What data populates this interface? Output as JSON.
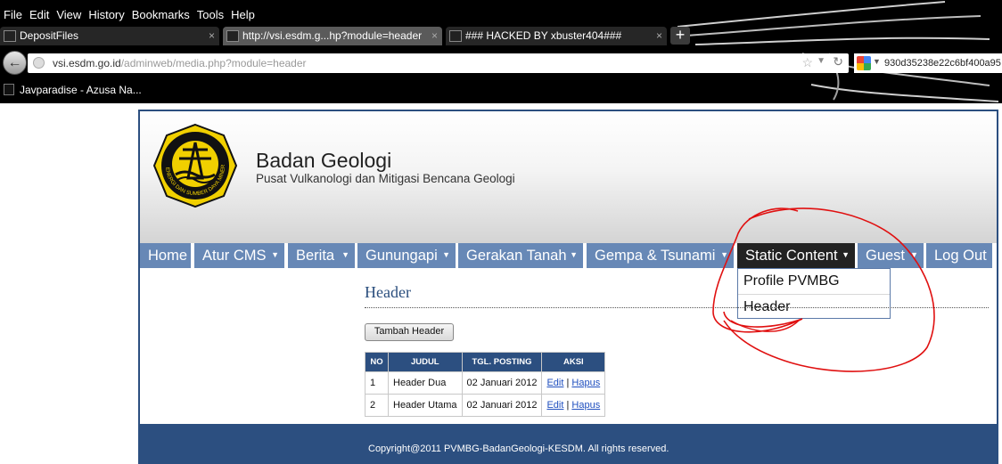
{
  "browser": {
    "menu": [
      "File",
      "Edit",
      "View",
      "History",
      "Bookmarks",
      "Tools",
      "Help"
    ],
    "tabs": [
      {
        "title": "DepositFiles",
        "close": "×"
      },
      {
        "title": "http://vsi.esdm.g...hp?module=header",
        "close": "×"
      },
      {
        "title": "### HACKED BY xbuster404###",
        "close": "×"
      }
    ],
    "new_tab": "+",
    "back": "←",
    "url_domain": "vsi.esdm.go.id",
    "url_path": "/adminweb/media.php?module=header",
    "search_value": "930d35238e22c6bf400a95",
    "bookmark": "Javparadise - Azusa Na..."
  },
  "site": {
    "title": "Badan Geologi",
    "subtitle": "Pusat Vulkanologi dan Mitigasi Bencana Geologi",
    "logo_ring_text": "ENERGI DAN SUMBER DAYA MINERAL",
    "nav": [
      "Home",
      "Atur CMS",
      "Berita",
      "Gunungapi",
      "Gerakan Tanah",
      "Gempa & Tsunami",
      "Static Content",
      "Guest",
      "Log Out"
    ],
    "nav_caret": "▼",
    "dropdown": [
      "Profile PVMBG",
      "Header"
    ],
    "footer": "Copyright@2011 PVMBG-BadanGeologi-KESDM. All rights reserved."
  },
  "content": {
    "title": "Header",
    "add_button": "Tambah Header",
    "table": {
      "headers": [
        "NO",
        "JUDUL",
        "TGL. POSTING",
        "AKSI"
      ],
      "rows": [
        {
          "no": "1",
          "judul": "Header Dua",
          "tgl": "02 Januari 2012",
          "edit": "Edit",
          "sep": "|",
          "hapus": "Hapus"
        },
        {
          "no": "2",
          "judul": "Header Utama",
          "tgl": "02 Januari 2012",
          "edit": "Edit",
          "sep": "|",
          "hapus": "Hapus"
        }
      ]
    }
  },
  "colors": {
    "nav_bg": "#6788b6",
    "nav_active_bg": "#222222",
    "brand_blue": "#2c4f80",
    "annotation_red": "#e01010"
  }
}
